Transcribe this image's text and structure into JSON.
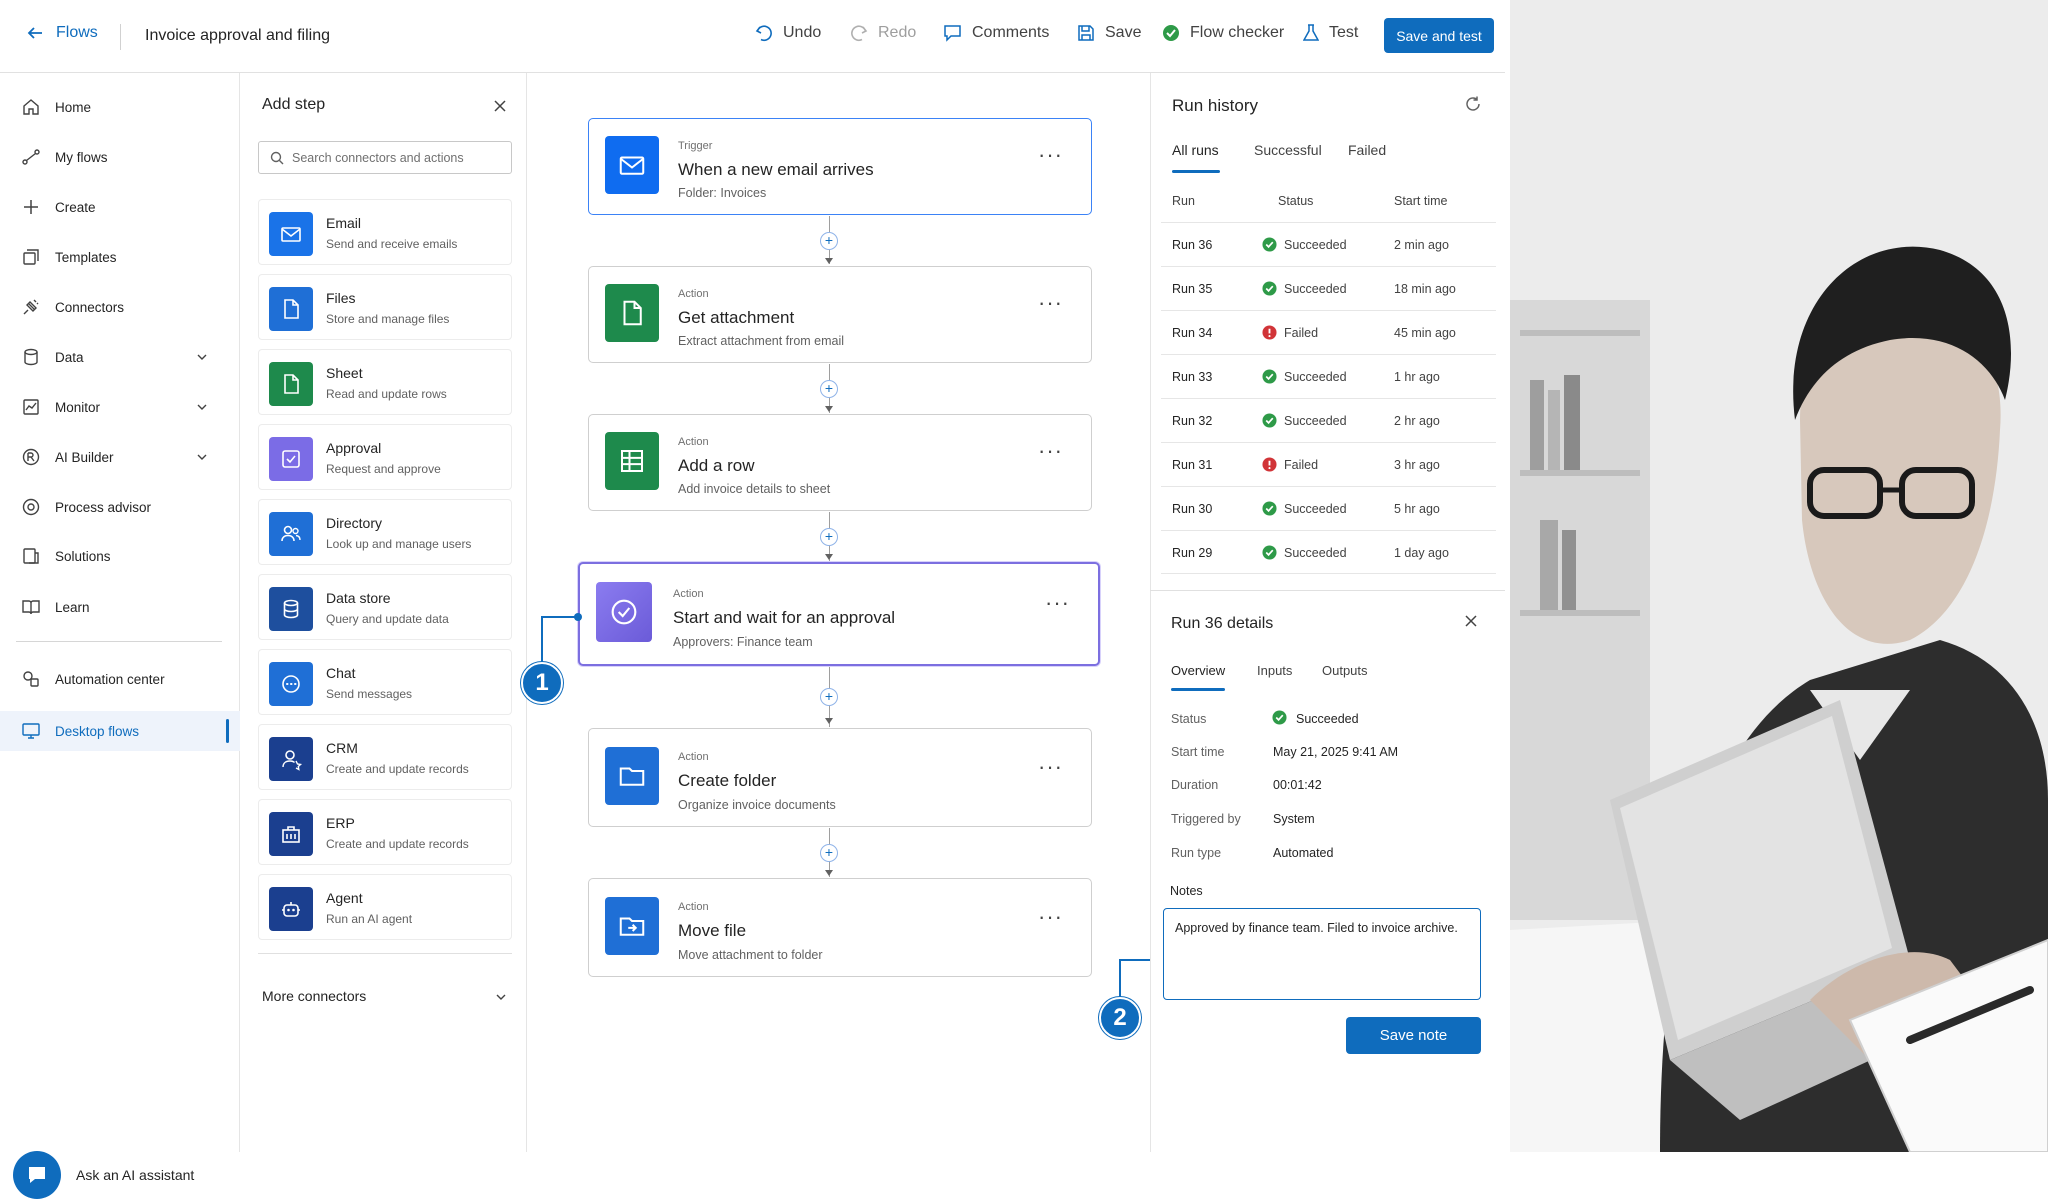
{
  "header": {
    "back_label": "Flows",
    "flow_title": "Invoice approval and filing",
    "undo": "Undo",
    "redo": "Redo",
    "comments": "Comments",
    "save": "Save",
    "flow_checker": "Flow checker",
    "test": "Test",
    "save_and_test": "Save and test"
  },
  "nav": {
    "items": [
      {
        "label": "Home",
        "icon": "home-icon"
      },
      {
        "label": "My flows",
        "icon": "flows-icon"
      },
      {
        "label": "Create",
        "icon": "plus-icon"
      },
      {
        "label": "Templates",
        "icon": "templates-icon"
      },
      {
        "label": "Connectors",
        "icon": "connectors-icon"
      },
      {
        "label": "Data",
        "icon": "database-icon"
      },
      {
        "label": "Monitor",
        "icon": "monitor-icon"
      },
      {
        "label": "AI Builder",
        "icon": "ai-builder-icon"
      },
      {
        "label": "Process advisor",
        "icon": "process-advisor-icon"
      },
      {
        "label": "Solutions",
        "icon": "solutions-icon"
      },
      {
        "label": "Learn",
        "icon": "book-icon"
      },
      {
        "label": "Automation center",
        "icon": "automation-center-icon"
      },
      {
        "label": "Desktop flows",
        "icon": "desktop-icon"
      }
    ],
    "assistant_label": "Ask an AI assistant"
  },
  "add_step": {
    "title": "Add step",
    "search_placeholder": "Search connectors and actions",
    "connectors": [
      {
        "name": "Email",
        "desc": "Send and receive emails",
        "color": "#1a73e8"
      },
      {
        "name": "Files",
        "desc": "Store and manage files",
        "color": "#1f6fd6"
      },
      {
        "name": "Sheet",
        "desc": "Read and update rows",
        "color": "#1e8a4c"
      },
      {
        "name": "Approval",
        "desc": "Request and approve",
        "color": "#7b6ce6"
      },
      {
        "name": "Directory",
        "desc": "Look up and manage users",
        "color": "#1f6fd6"
      },
      {
        "name": "Data store",
        "desc": "Query and update data",
        "color": "#1e4f9e"
      },
      {
        "name": "Chat",
        "desc": "Send messages",
        "color": "#1f6fd6"
      },
      {
        "name": "CRM",
        "desc": "Create and update records",
        "color": "#1b3f8f"
      },
      {
        "name": "ERP",
        "desc": "Create and update records",
        "color": "#1b3f8f"
      },
      {
        "name": "Agent",
        "desc": "Run an AI agent",
        "color": "#1b3f8f"
      }
    ],
    "more_label": "More connectors"
  },
  "flow": {
    "steps": [
      {
        "kind": "Trigger",
        "title": "When a new email arrives",
        "subtitle": "Folder: Invoices"
      },
      {
        "kind": "Action",
        "title": "Get attachment",
        "subtitle": "Extract attachment from email"
      },
      {
        "kind": "Action",
        "title": "Add a row",
        "subtitle": "Add invoice details to sheet"
      },
      {
        "kind": "Action",
        "title": "Start and wait for an approval",
        "subtitle": "Approvers: Finance team"
      },
      {
        "kind": "Action",
        "title": "Create folder",
        "subtitle": "Organize invoice documents"
      },
      {
        "kind": "Action",
        "title": "Move file",
        "subtitle": "Move attachment to folder"
      }
    ],
    "callout_1": "1",
    "callout_2": "2"
  },
  "run_history": {
    "title": "Run history",
    "tabs": [
      "All runs",
      "Successful",
      "Failed"
    ],
    "columns": [
      "Run",
      "Status",
      "Start time"
    ],
    "rows": [
      {
        "run": "Run 36",
        "status": "Succeeded",
        "time": "2 min ago"
      },
      {
        "run": "Run 35",
        "status": "Succeeded",
        "time": "18 min ago"
      },
      {
        "run": "Run 34",
        "status": "Failed",
        "time": "45 min ago"
      },
      {
        "run": "Run 33",
        "status": "Succeeded",
        "time": "1 hr ago"
      },
      {
        "run": "Run 32",
        "status": "Succeeded",
        "time": "2 hr ago"
      },
      {
        "run": "Run 31",
        "status": "Failed",
        "time": "3 hr ago"
      },
      {
        "run": "Run 30",
        "status": "Succeeded",
        "time": "5 hr ago"
      },
      {
        "run": "Run 29",
        "status": "Succeeded",
        "time": "1 day ago"
      }
    ],
    "colors": {
      "success": "#2e9a48",
      "fail": "#d13438"
    }
  },
  "details": {
    "title": "Run 36 details",
    "tabs": [
      "Overview",
      "Inputs",
      "Outputs"
    ],
    "fields": [
      {
        "key": "Status",
        "value": "Succeeded"
      },
      {
        "key": "Start time",
        "value": "May 21, 2025 9:41 AM"
      },
      {
        "key": "Duration",
        "value": "00:01:42"
      },
      {
        "key": "Triggered by",
        "value": "System"
      },
      {
        "key": "Run type",
        "value": "Automated"
      }
    ],
    "notes_label": "Notes",
    "notes_value": "Approved by finance team. Filed to invoice archive.",
    "save_note": "Save note"
  },
  "accent": "#0f6cbd"
}
